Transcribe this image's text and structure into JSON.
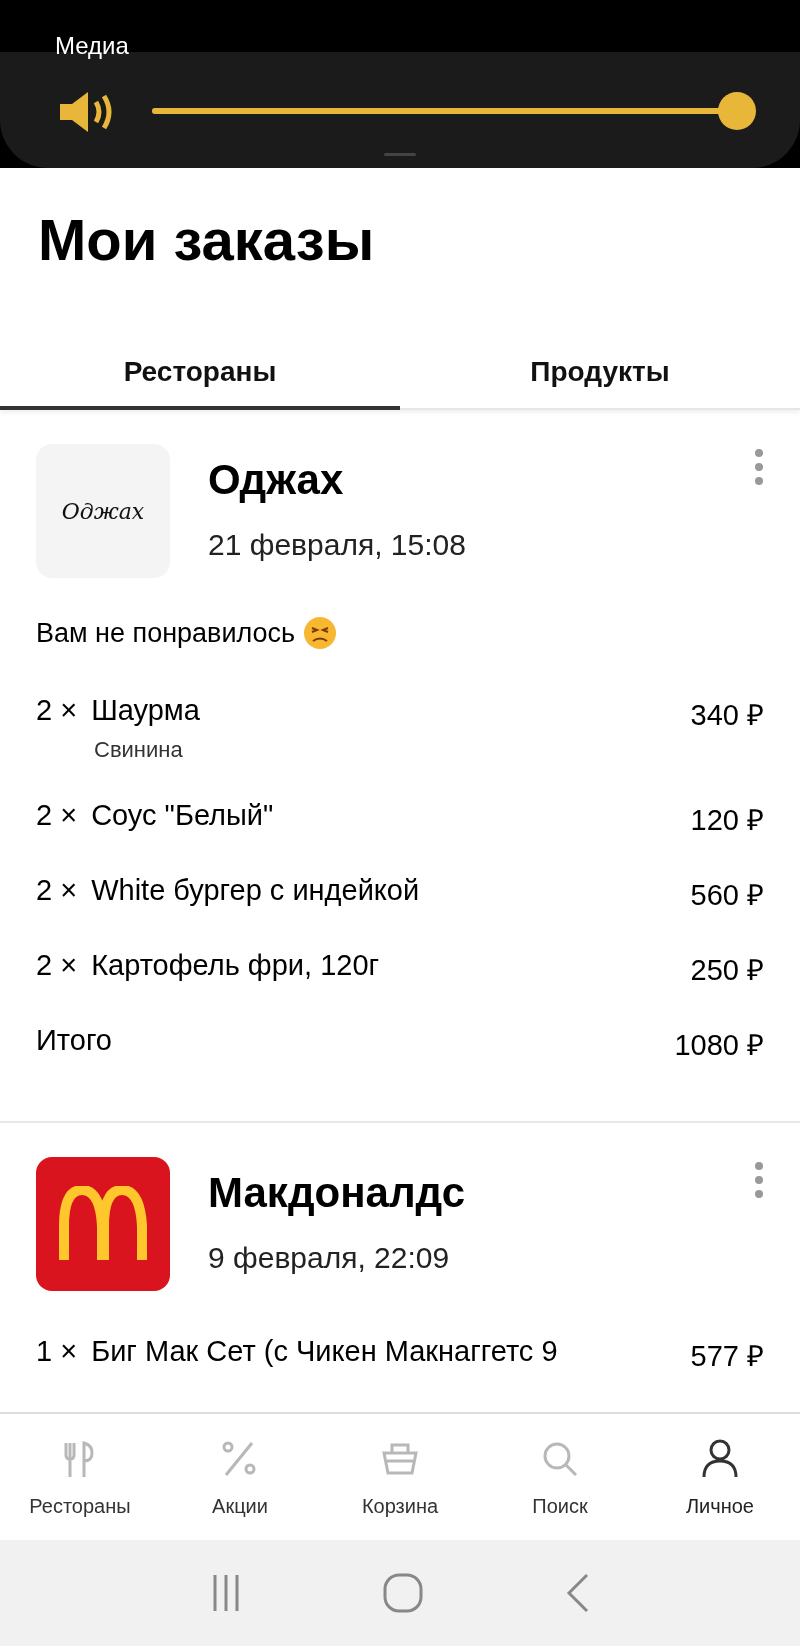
{
  "volume_panel": {
    "label": "Медиа",
    "level": 1.0
  },
  "page_title": "Мои заказы",
  "tabs": [
    {
      "label": "Рестораны",
      "selected": true
    },
    {
      "label": "Продукты",
      "selected": false
    }
  ],
  "orders": [
    {
      "restaurant": "Оджах",
      "kind": "text",
      "logo_text": "Оджах",
      "date": "21 февраля, 15:08",
      "feedback": "Вам не понравилось",
      "items": [
        {
          "qty": "2 ×",
          "name": "Шаурма",
          "option": "Свинина",
          "price": "340 ₽"
        },
        {
          "qty": "2 ×",
          "name": "Соус \"Белый\"",
          "price": "120 ₽"
        },
        {
          "qty": "2 ×",
          "name": "White бургер с индейкой",
          "price": "560 ₽"
        },
        {
          "qty": "2 ×",
          "name": "Картофель фри, 120г",
          "price": "250 ₽"
        }
      ],
      "total_label": "Итого",
      "total": "1080 ₽"
    },
    {
      "restaurant": "Макдоналдс",
      "kind": "arches",
      "date": "9 февраля, 22:09",
      "items": [
        {
          "qty": "1 ×",
          "name": "Биг Мак Сет (с Чикен Макнаггетс 9",
          "price": "577 ₽"
        }
      ]
    }
  ],
  "bottom_nav": [
    {
      "label": "Рестораны",
      "kind": "cutlery",
      "selected": false
    },
    {
      "label": "Акции",
      "kind": "percent",
      "selected": false
    },
    {
      "label": "Корзина",
      "kind": "basket",
      "selected": false
    },
    {
      "label": "Поиск",
      "kind": "search",
      "selected": false
    },
    {
      "label": "Личное",
      "kind": "person",
      "selected": true
    }
  ]
}
